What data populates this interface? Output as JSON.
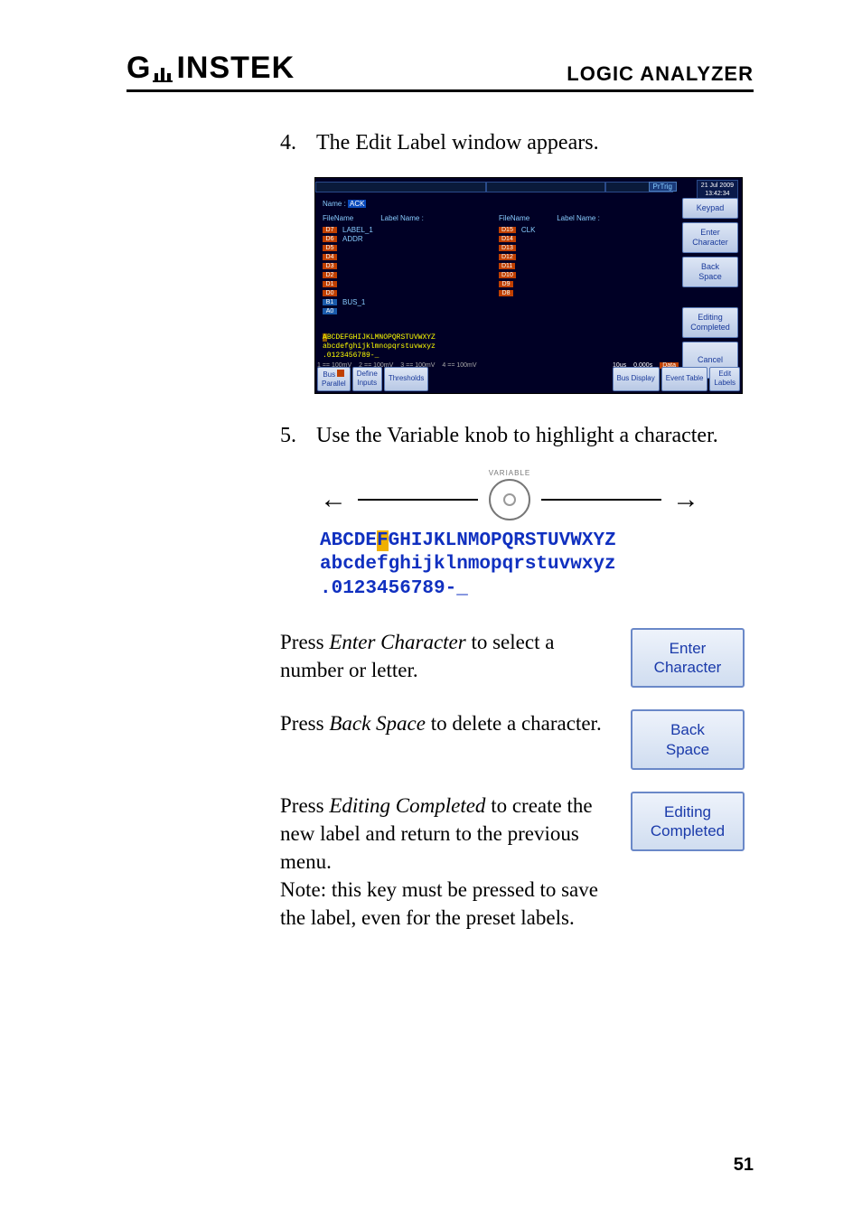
{
  "header": {
    "logo_g": "G",
    "logo_rest": "INSTEK",
    "right": "LOGIC ANALYZER"
  },
  "step4": {
    "num": "4.",
    "text": "The Edit Label window appears."
  },
  "screenshot": {
    "prtrig": "PrTrig",
    "date_line1": "21 Jul 2009",
    "date_line2": "13:42:34",
    "name_label": "Name :",
    "name_value": "ACK",
    "col_l_filename": "FileName",
    "col_l_labelname": "Label Name :",
    "col_r_filename": "FileName",
    "col_r_labelname": "Label Name :",
    "left_rows": [
      {
        "chip": "D7",
        "label": "LABEL_1"
      },
      {
        "chip": "D6",
        "label": "ADDR"
      },
      {
        "chip": "D5",
        "label": ""
      },
      {
        "chip": "D4",
        "label": ""
      },
      {
        "chip": "D3",
        "label": ""
      },
      {
        "chip": "D2",
        "label": ""
      },
      {
        "chip": "D1",
        "label": ""
      },
      {
        "chip": "D0",
        "label": ""
      },
      {
        "chip": "B1",
        "label": "BUS_1"
      },
      {
        "chip": "A0",
        "label": ""
      }
    ],
    "right_rows": [
      {
        "chip": "D15",
        "label": "CLK"
      },
      {
        "chip": "D14",
        "label": ""
      },
      {
        "chip": "D13",
        "label": ""
      },
      {
        "chip": "D12",
        "label": ""
      },
      {
        "chip": "D11",
        "label": ""
      },
      {
        "chip": "D10",
        "label": ""
      },
      {
        "chip": "D9",
        "label": ""
      },
      {
        "chip": "D8",
        "label": ""
      }
    ],
    "charset_line1_pre": "A",
    "charset_line1_hl": "B",
    "charset_line1_post": "CDEFGHIJKLMNOPQRSTUVWXYZ",
    "charset_line2": "abcdefghijklmnopqrstuvwxyz",
    "charset_line3": ".0123456789-_",
    "status_10us": "10us",
    "status_0s": "0.000s",
    "status_data": "Data",
    "bottom": {
      "bus_parallel_l1": "Bus",
      "bus_parallel_l2": "Parallel",
      "define_l1": "Define",
      "define_l2": "Inputs",
      "thresholds": "Thresholds",
      "bus_display": "Bus Display",
      "event_table": "Event Table",
      "edit_l1": "Edit",
      "edit_l2": "Labels"
    },
    "sidebar": {
      "keypad": "Keypad",
      "enter_l1": "Enter",
      "enter_l2": "Character",
      "back_l1": "Back",
      "back_l2": "Space",
      "editing_l1": "Editing",
      "editing_l2": "Completed",
      "cancel": "Cancel"
    }
  },
  "step5": {
    "num": "5.",
    "text": "Use the Variable knob to highlight a character."
  },
  "variable": {
    "knob_label": "VARIABLE",
    "line1_pre": "ABCDE",
    "line1_hl": "F",
    "line1_post": "GHIJKLNMOPQRSTUVWXYZ",
    "line2": "abcdefghijklnmopqrstuvwxyz",
    "line3": ".0123456789-_"
  },
  "action_enter": {
    "pre": "Press ",
    "em": "Enter Character",
    "post": " to select a number or letter.",
    "btn_l1": "Enter",
    "btn_l2": "Character"
  },
  "action_back": {
    "pre": "Press ",
    "em": "Back Space",
    "post": " to delete a character.",
    "btn_l1": "Back",
    "btn_l2": "Space"
  },
  "action_editing": {
    "pre": "Press ",
    "em": "Editing Completed",
    "post": " to create the new label and return to the previous menu.",
    "note": "Note: this key must be pressed to save the label, even for the preset labels.",
    "btn_l1": "Editing",
    "btn_l2": "Completed"
  },
  "page_num": "51"
}
